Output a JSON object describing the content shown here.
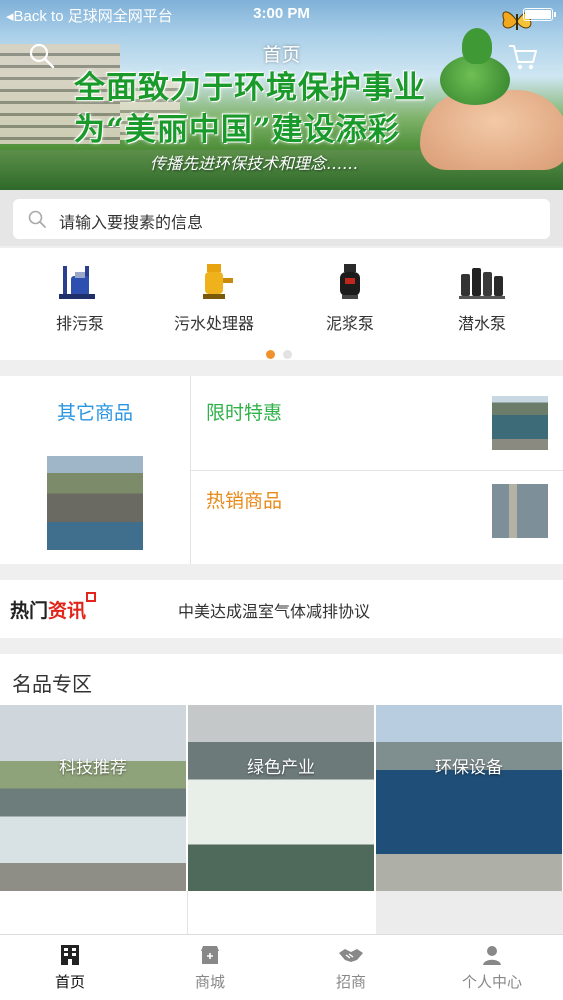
{
  "status_bar": {
    "back_text": "◂Back to 足球网全网平台",
    "time": "3:00 PM"
  },
  "header": {
    "title": "首页",
    "banner": {
      "line1": "全面致力于环境保护事业",
      "line2": "为“美丽中国”建设添彩",
      "line3": "传播先进环保技术和理念……"
    }
  },
  "search": {
    "placeholder": "请输入要搜素的信息"
  },
  "categories": [
    {
      "label": "排污泵",
      "icon": "pump-icon"
    },
    {
      "label": "污水处理器",
      "icon": "sewage-processor-icon"
    },
    {
      "label": "泥浆泵",
      "icon": "slurry-pump-icon"
    },
    {
      "label": "潜水泵",
      "icon": "submersible-pump-icon"
    }
  ],
  "carousel": {
    "active_color": "#f0922b",
    "inactive_color": "#e2e2e2"
  },
  "promo": {
    "other_goods": "其它商品",
    "limited_offer": "限时特惠",
    "hot_sale": "热销商品"
  },
  "news": {
    "logo_a": "热门",
    "logo_b": "资讯",
    "headline": "中美达成温室气体减排协议"
  },
  "brand_zone": {
    "title": "名品专区",
    "tiles": [
      {
        "caption": "科技推荐"
      },
      {
        "caption": "绿色产业"
      },
      {
        "caption": "环保设备"
      }
    ]
  },
  "tabbar": {
    "items": [
      {
        "label": "首页",
        "icon": "home-icon",
        "active": true
      },
      {
        "label": "商城",
        "icon": "store-icon",
        "active": false
      },
      {
        "label": "招商",
        "icon": "handshake-icon",
        "active": false
      },
      {
        "label": "个人中心",
        "icon": "user-icon",
        "active": false
      }
    ]
  }
}
